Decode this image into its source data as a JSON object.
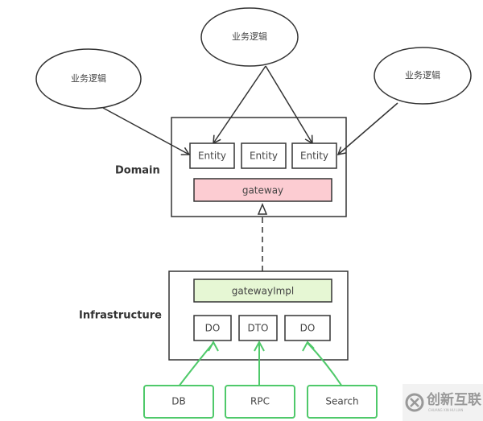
{
  "diagram": {
    "business_nodes": [
      {
        "label": "业务逻辑"
      },
      {
        "label": "业务逻辑"
      },
      {
        "label": "业务逻辑"
      }
    ],
    "domain": {
      "label": "Domain",
      "entities": [
        "Entity",
        "Entity",
        "Entity"
      ],
      "gateway": "gateway"
    },
    "infrastructure": {
      "label": "Infrastructure",
      "gateway_impl": "gatewayImpl",
      "objects": [
        "DO",
        "DTO",
        "DO"
      ]
    },
    "sources": [
      "DB",
      "RPC",
      "Search"
    ],
    "colors": {
      "stroke": "#333333",
      "gateway_fill": "#fcccd2",
      "gateway_impl_fill": "#e6f7d4",
      "source_stroke": "#4fc96a"
    },
    "watermark": {
      "text": "创新互联",
      "subtext": "CHUANG XIN HU LIAN"
    }
  }
}
